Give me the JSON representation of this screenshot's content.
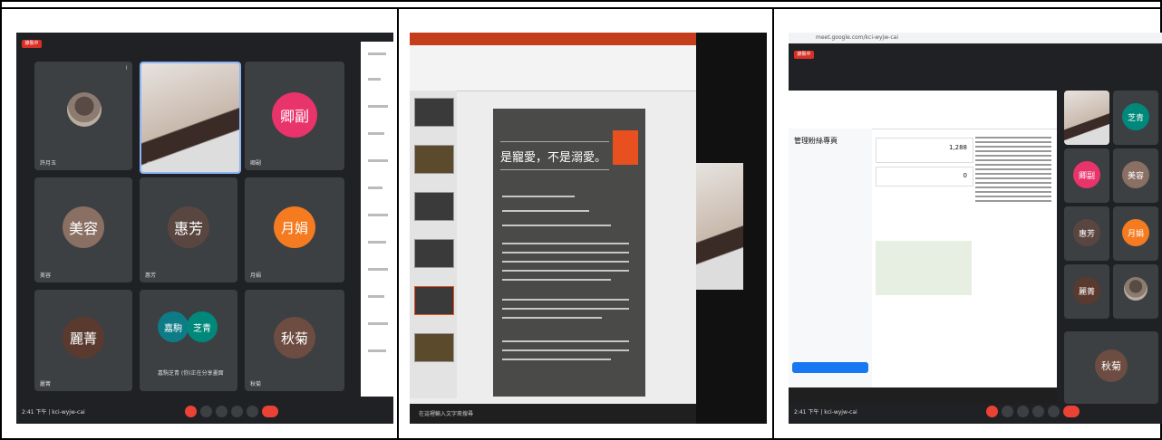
{
  "panels": {
    "left": {
      "record_label": "錄製中",
      "tiles": [
        {
          "name": "許月玉",
          "initial": "",
          "color": ""
        },
        {
          "name": "劉育婷",
          "initial": "",
          "color": ""
        },
        {
          "name": "卿副",
          "initial": "卿副",
          "color": "#e8336b"
        },
        {
          "name": "美容",
          "initial": "美容",
          "color": "#8a6f63"
        },
        {
          "name": "惠芳",
          "initial": "惠芳",
          "color": "#5a4640"
        },
        {
          "name": "月娟",
          "initial": "月娟",
          "color": "#f47b20"
        },
        {
          "name": "麗菁",
          "initial": "麗菁",
          "color": "#5a3a2e"
        },
        {
          "name": "嘉駒",
          "initial": "嘉駒",
          "color": "#0e7c86"
        },
        {
          "name": "芝青",
          "initial": "芝青",
          "color": "#00897b"
        },
        {
          "name": "秋菊",
          "initial": "秋菊",
          "color": "#6d4c41"
        }
      ],
      "shared_caption": "嘉駒芝青 (你)正在分享畫面",
      "time": "2:41 下午 | kci-wyjw-cai"
    },
    "middle": {
      "slide_title": "是寵愛，不是溺愛。",
      "bullets": [
        "",
        "",
        "",
        "",
        "",
        ""
      ],
      "search_placeholder": "在這裡輸入文字來搜尋"
    },
    "right": {
      "url": "meet.google.com/kci-wyjw-cai",
      "page_title": "管理粉絲專頁",
      "stat_value": "1,288",
      "stat_value2": "0",
      "side_names": [
        "芝青",
        "卿副",
        "美容",
        "惠芳",
        "月娟",
        "麗菁",
        "秋菊"
      ],
      "time": "2:41 下午 | kci-wyjw-cai"
    }
  }
}
